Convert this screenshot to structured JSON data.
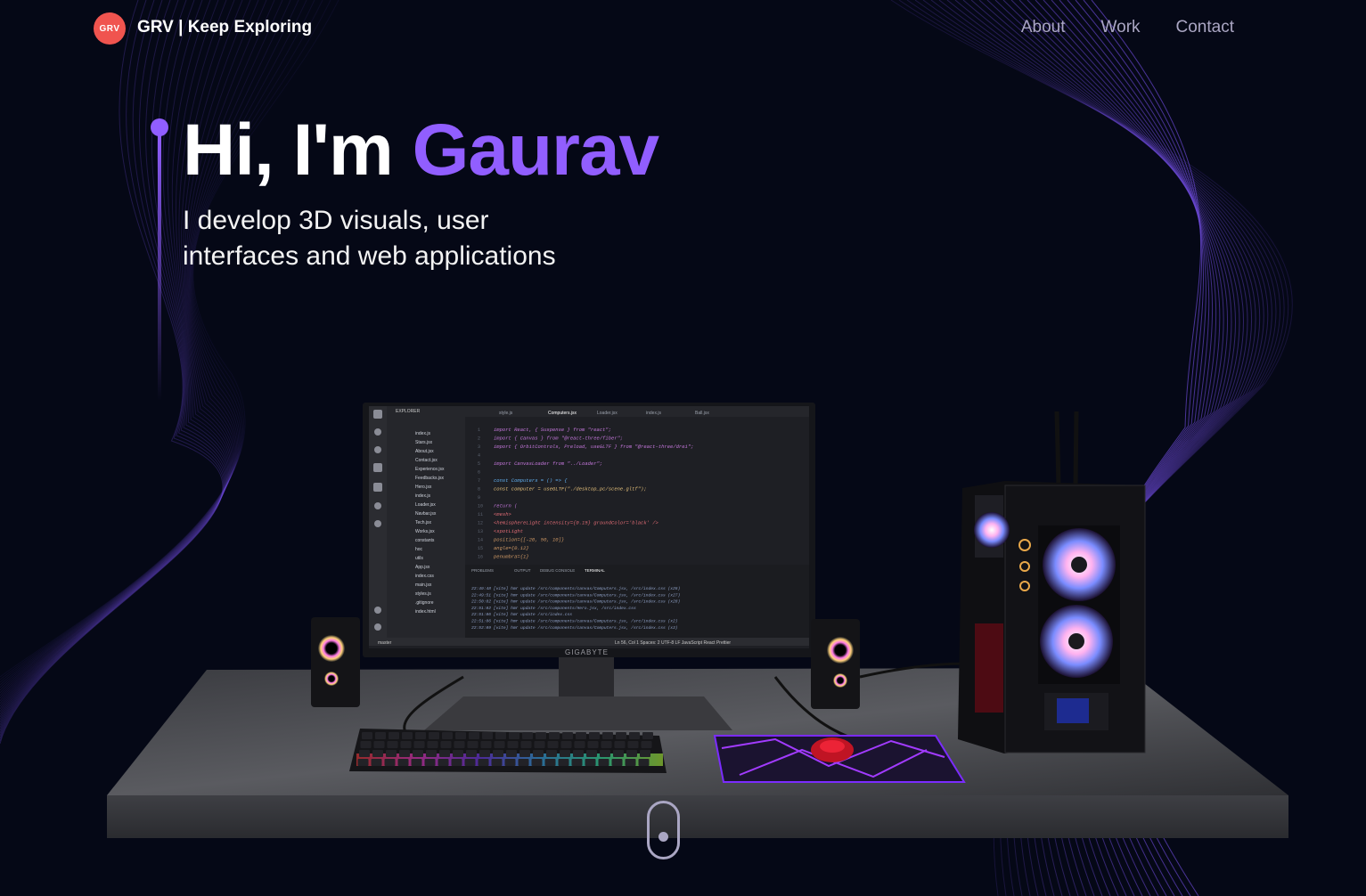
{
  "nav": {
    "logo_text": "GRV",
    "brand": "GRV | Keep Exploring",
    "links": [
      "About",
      "Work",
      "Contact"
    ]
  },
  "hero": {
    "greeting": "Hi, I'm",
    "name": "Gaurav",
    "subtitle_line1": "I develop 3D visuals, user",
    "subtitle_line2": "interfaces and web applications"
  },
  "monitor": {
    "brand_label": "GIGABYTE",
    "editor": {
      "explorer_title": "EXPLORER",
      "tabs": [
        "style.js",
        "Computers.jsx",
        "Loader.jsx",
        "index.js",
        "Ball.jsx"
      ],
      "files": [
        "index.js",
        "Stars.jsx",
        "About.jsx",
        "Contact.jsx",
        "Experience.jsx",
        "Feedbacks.jsx",
        "Hero.jsx",
        "index.js",
        "Loader.jsx",
        "Navbar.jsx",
        "Tech.jsx",
        "Works.jsx",
        "constants",
        "hoc",
        "utils",
        "App.jsx",
        "index.css",
        "main.jsx",
        "styles.js",
        ".gitignore",
        "index.html"
      ],
      "code_lines": [
        "import React, { Suspense } from \"react\";",
        "import { Canvas } from \"@react-three/fiber\";",
        "import { OrbitControls, Preload, useGLTF } from \"@react-three/drei\";",
        "",
        "import CanvasLoader from \"../Loader\";",
        "",
        "const Computers = () => {",
        "  const computer = useGLTF(\"./desktop_pc/scene.gltf\");",
        "",
        "  return (",
        "    <mesh>",
        "      <hemisphereLight intensity={0.15} groundColor='black' />",
        "      <spotLight",
        "        position={[-20, 50, 10]}",
        "        angle={0.12}",
        "        penumbra={1}"
      ],
      "panel_tabs": [
        "PROBLEMS",
        "OUTPUT",
        "DEBUG CONSOLE",
        "TERMINAL"
      ],
      "terminal_lines": [
        "22:49:48 [vite] hmr update /src/components/canvas/Computers.jsx, /src/index.css (x26)",
        "22:49:51 [vite] hmr update /src/components/canvas/Computers.jsx, /src/index.css (x27)",
        "22:50:02 [vite] hmr update /src/components/canvas/Computers.jsx, /src/index.css (x28)",
        "22:51:02 [vite] hmr update /src/components/Hero.jsx, /src/index.css",
        "22:51:06 [vite] hmr update /src/index.css",
        "22:51:06 [vite] hmr update /src/components/canvas/Computers.jsx, /src/index.css (x2)",
        "22:52:09 [vite] hmr update /src/components/canvas/Computers.jsx, /src/index.css (x3)"
      ],
      "status_left": "master",
      "status_right": "Ln 56, Col 1   Spaces: 2   UTF-8   LF   JavaScript React   Prettier"
    }
  },
  "colors": {
    "background": "#050816",
    "accent": "#915eff",
    "logo": "#f0544f",
    "nav_text": "#aaa6c3"
  },
  "icons": {
    "scroll": "mouse-scroll-indicator-icon"
  }
}
